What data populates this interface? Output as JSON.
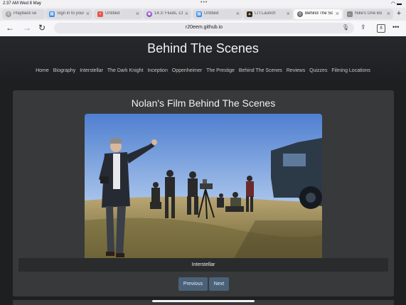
{
  "status": {
    "time": "2:37 AM  Wed 8 May"
  },
  "tabs": [
    {
      "label": "Playback sessi",
      "icon": "globe-icon",
      "color": "#9a9a9a"
    },
    {
      "label": "Sign in to your",
      "icon": "microsoft-icon",
      "color": "#3d8ee6"
    },
    {
      "label": "Untitled",
      "icon": "doc-icon",
      "color": "#e8584a"
    },
    {
      "label": "14.3: Fluids, Ch",
      "icon": "chem-icon",
      "color": "#9c4fd0"
    },
    {
      "label": "Untitled",
      "icon": "microsoft-icon",
      "color": "#3d8ee6"
    },
    {
      "label": "LTI Launch",
      "icon": "lti-icon",
      "color": "#2b2b2b"
    },
    {
      "label": "Behind The Sc",
      "icon": "globe-icon",
      "color": "#666666",
      "active": true
    },
    {
      "label": "Nike's One Bo",
      "icon": "back-arrow-icon",
      "color": "#888888"
    }
  ],
  "address": {
    "url": "r20eem.github.io"
  },
  "site": {
    "title": "Behind The Scenes",
    "nav": [
      "Home",
      "Biography",
      "Interstellar",
      "The Dark Knight",
      "Inception",
      "Oppenheimer",
      "The Prestige",
      "Behind The Scenes",
      "Reviews",
      "Quizzes",
      "Filming Locations"
    ]
  },
  "gallery": {
    "heading": "Nolan's Film Behind The Scenes",
    "caption": "Interstellar",
    "prev_label": "Previous",
    "next_label": "Next"
  },
  "colors": {
    "page_bg": "#1e1f21",
    "card_bg": "#38393b",
    "button_bg": "#4a6178"
  }
}
